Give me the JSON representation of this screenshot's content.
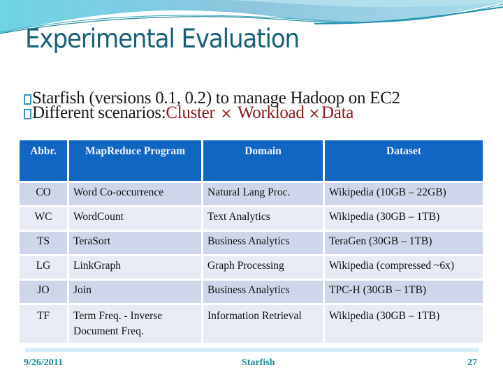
{
  "slide": {
    "title": "Experimental Evaluation",
    "bullets": [
      {
        "text": "Starfish (versions 0.1, 0.2) to manage Hadoop on EC2"
      },
      {
        "prefix": "Different scenarios: ",
        "parts": [
          "Cluster",
          "Workload",
          "Data"
        ],
        "separator": "×"
      }
    ],
    "colors": {
      "title": "#17607a",
      "header_bg": "#1166c2",
      "row_odd": "#cfd6e9",
      "row_even": "#e8ebf4",
      "accent_red": "#8b1a1a",
      "footer_text": "#1a8a94"
    }
  },
  "table": {
    "headers": [
      "Abbr.",
      "MapReduce Program",
      "Domain",
      "Dataset"
    ],
    "rows": [
      [
        "CO",
        "Word Co-occurrence",
        "Natural Lang Proc.",
        "Wikipedia (10GB – 22GB)"
      ],
      [
        "WC",
        "WordCount",
        "Text Analytics",
        "Wikipedia (30GB – 1TB)"
      ],
      [
        "TS",
        "TeraSort",
        "Business Analytics",
        "TeraGen (30GB – 1TB)"
      ],
      [
        "LG",
        "LinkGraph",
        "Graph Processing",
        "Wikipedia (compressed ~6x)"
      ],
      [
        "JO",
        "Join",
        "Business Analytics",
        "TPC-H (30GB – 1TB)"
      ],
      [
        "TF",
        "Term Freq. - Inverse Document Freq.",
        "Information Retrieval",
        "Wikipedia (30GB – 1TB)"
      ]
    ]
  },
  "footer": {
    "date": "9/26/2011",
    "center": "Starfish",
    "page": "27"
  }
}
